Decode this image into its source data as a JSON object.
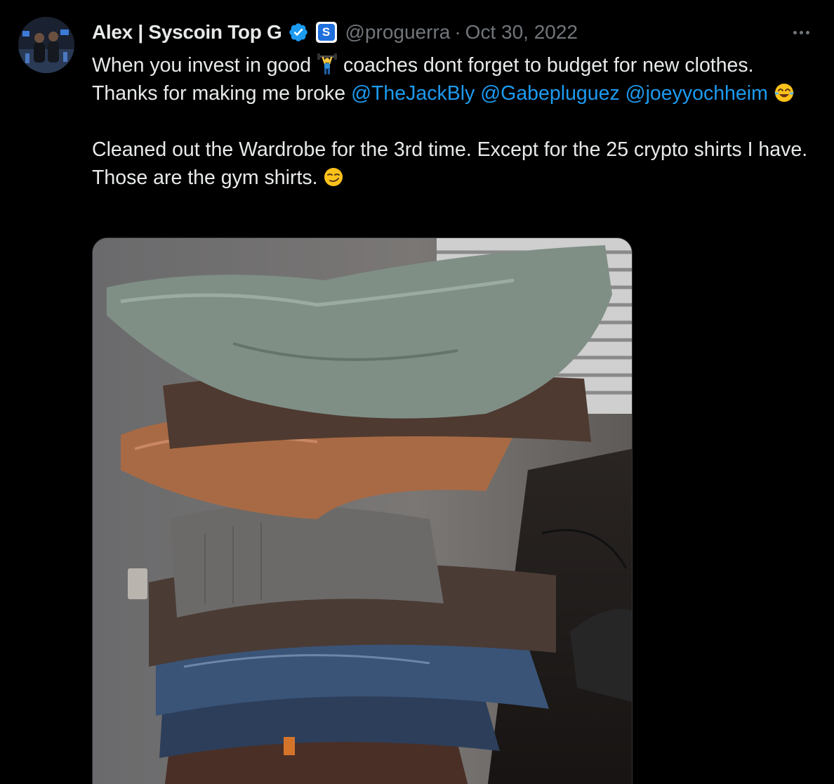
{
  "author": {
    "display_name": "Alex | Syscoin Top G",
    "handle": "@proguerra",
    "separator": "·",
    "date": "Oct 30, 2022",
    "affiliate_badge_letter": "S",
    "verified_icon": "verified-badge-icon"
  },
  "tweet": {
    "line1_before": "When you invest in good ",
    "line1_emoji": "weightlifter-emoji",
    "line1_after": " coaches dont forget to budget for new clothes. Thanks for making me broke ",
    "mentions": [
      "@TheJackBly",
      "@Gabepluguez",
      "@joeyyochheim"
    ],
    "mention_emoji": "tears-of-joy-emoji",
    "para2": "Cleaned out the Wardrobe for the 3rd time. Except for the 25 crypto shirts I have. Those are the gym shirts. ",
    "para2_emoji": "smirking-face-emoji"
  },
  "media": {
    "description_icon": "photo-stack-of-clothes"
  },
  "colors": {
    "background": "#000000",
    "text": "#e7e9ea",
    "secondary": "#71767b",
    "link": "#1d9bf0",
    "verified": "#1d9bf0"
  }
}
